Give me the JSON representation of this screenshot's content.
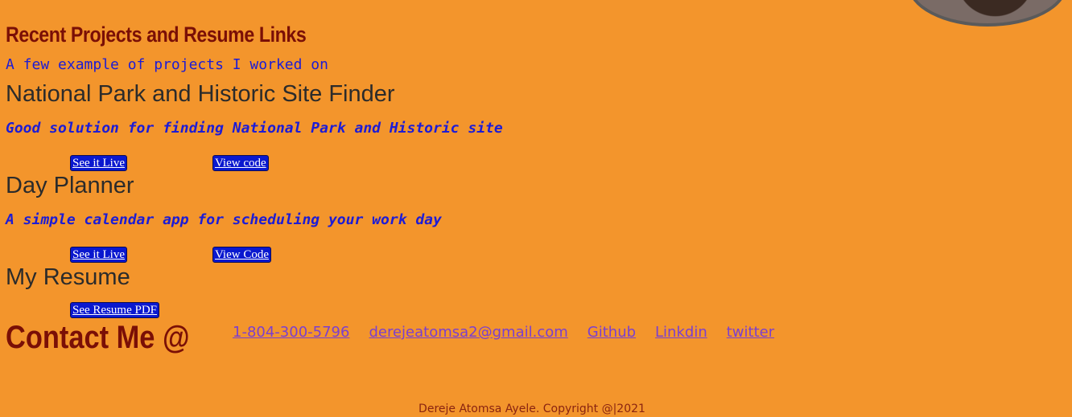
{
  "projects_section": {
    "title": "Recent Projects and Resume Links",
    "subtitle": "A few example of projects I worked on"
  },
  "projects": [
    {
      "title": "National Park and Historic Site Finder",
      "description": "Good solution for finding National Park and Historic site",
      "live_label": "See it Live",
      "code_label": "View code"
    },
    {
      "title": "Day Planner",
      "description": "A simple calendar app for scheduling your work day",
      "live_label": "See it Live",
      "code_label": "View Code"
    }
  ],
  "resume": {
    "title": "My Resume",
    "button_label": "See Resume PDF"
  },
  "contact": {
    "title": "Contact Me @",
    "phone": "1-804-300-5796",
    "email": "derejeatomsa2@gmail.com",
    "github": "Github",
    "linkedin": "Linkdin",
    "twitter": "twitter"
  },
  "footer": {
    "text": "Dereje Atomsa Ayele. Copyright @|2021"
  }
}
